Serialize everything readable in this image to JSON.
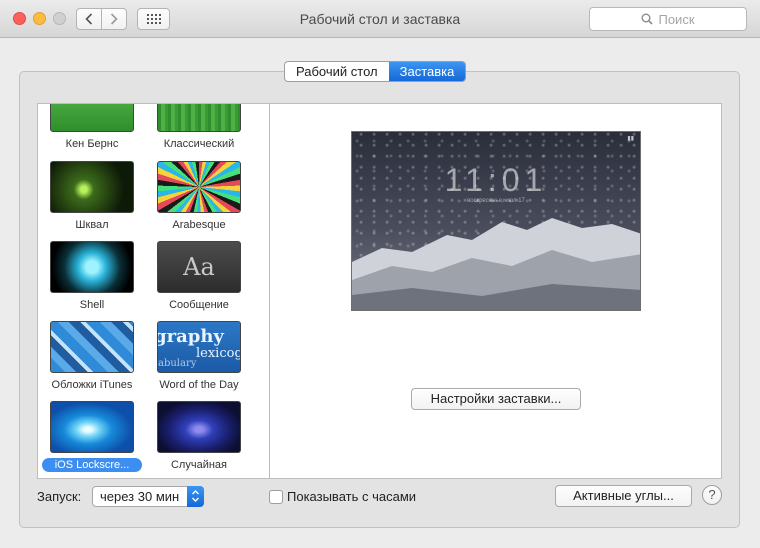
{
  "window": {
    "title": "Рабочий стол и заставка",
    "search_placeholder": "Поиск"
  },
  "tabs": [
    {
      "label": "Рабочий стол",
      "selected": false
    },
    {
      "label": "Заставка",
      "selected": true
    }
  ],
  "screensavers": [
    {
      "label": "Кен Бернс",
      "icon": "ken-burns-thumbnail"
    },
    {
      "label": "Классический",
      "icon": "classic-thumbnail"
    },
    {
      "label": "Шквал",
      "icon": "flurry-thumbnail"
    },
    {
      "label": "Arabesque",
      "icon": "arabesque-thumbnail"
    },
    {
      "label": "Shell",
      "icon": "shell-thumbnail"
    },
    {
      "label": "Сообщение",
      "icon": "message-thumbnail",
      "thumb_text": "Aa"
    },
    {
      "label": "Обложки iTunes",
      "icon": "itunes-artwork-thumbnail"
    },
    {
      "label": "Word of the Day",
      "icon": "word-of-the-day-thumbnail",
      "thumb_words": [
        "graphy",
        "lexicog",
        "abulary"
      ]
    },
    {
      "label": "iOS Lockscre...",
      "icon": "ios-lockscreen-thumbnail",
      "selected": true
    },
    {
      "label": "Случайная",
      "icon": "random-thumbnail"
    }
  ],
  "preview": {
    "time": "11:01",
    "date": "воскресенье, июл 17",
    "battery": "▮▮"
  },
  "saver_options_button": "Настройки заставки...",
  "start": {
    "label": "Запуск:",
    "value": "через 30 мин"
  },
  "show_clock": {
    "label": "Показывать с часами",
    "checked": false
  },
  "hot_corners_button": "Активные углы...",
  "help_button": "?",
  "colors": {
    "accent": "#1668d8",
    "selection": "#3c8ff1"
  }
}
